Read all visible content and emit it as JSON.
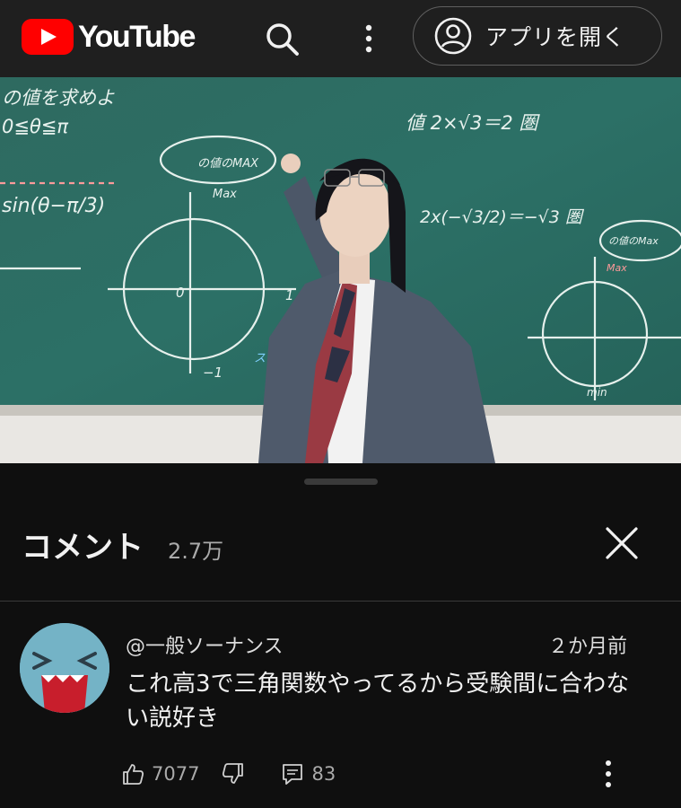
{
  "header": {
    "logo_text": "YouTube",
    "search_icon": "search-icon",
    "more_icon": "more-vertical-icon",
    "open_app_label": "アプリを開く",
    "open_app_icon": "account-circle-icon"
  },
  "video": {
    "board_texts": [
      "の値を求めよ",
      "0≦θ≦π",
      "sin(θ−π/3)",
      "値 2×√3＝2 圏",
      "2x(−√3/2)＝−√3 圏",
      "の値のMAX",
      "Max",
      "スタート",
      "0",
      "1",
      "−1",
      "Max",
      "min",
      "の値のMax"
    ]
  },
  "comments_panel": {
    "title": "コメント",
    "count": "2.7万",
    "close_icon": "close-icon",
    "comment": {
      "author": "@一般ソーナンス",
      "time": "２か月前",
      "text": "これ高3で三角関数やってるから受験間に合わない説好き",
      "likes": "7077",
      "replies": "83",
      "icons": [
        "like-icon",
        "dislike-icon",
        "reply-icon",
        "more-vertical-icon"
      ]
    }
  },
  "colors": {
    "background": "#0f0f0f",
    "topbar": "#1f1f1f",
    "brand_red": "#ff0000",
    "chalkboard": "#2f6f67",
    "avatar": "#74b3c6"
  }
}
